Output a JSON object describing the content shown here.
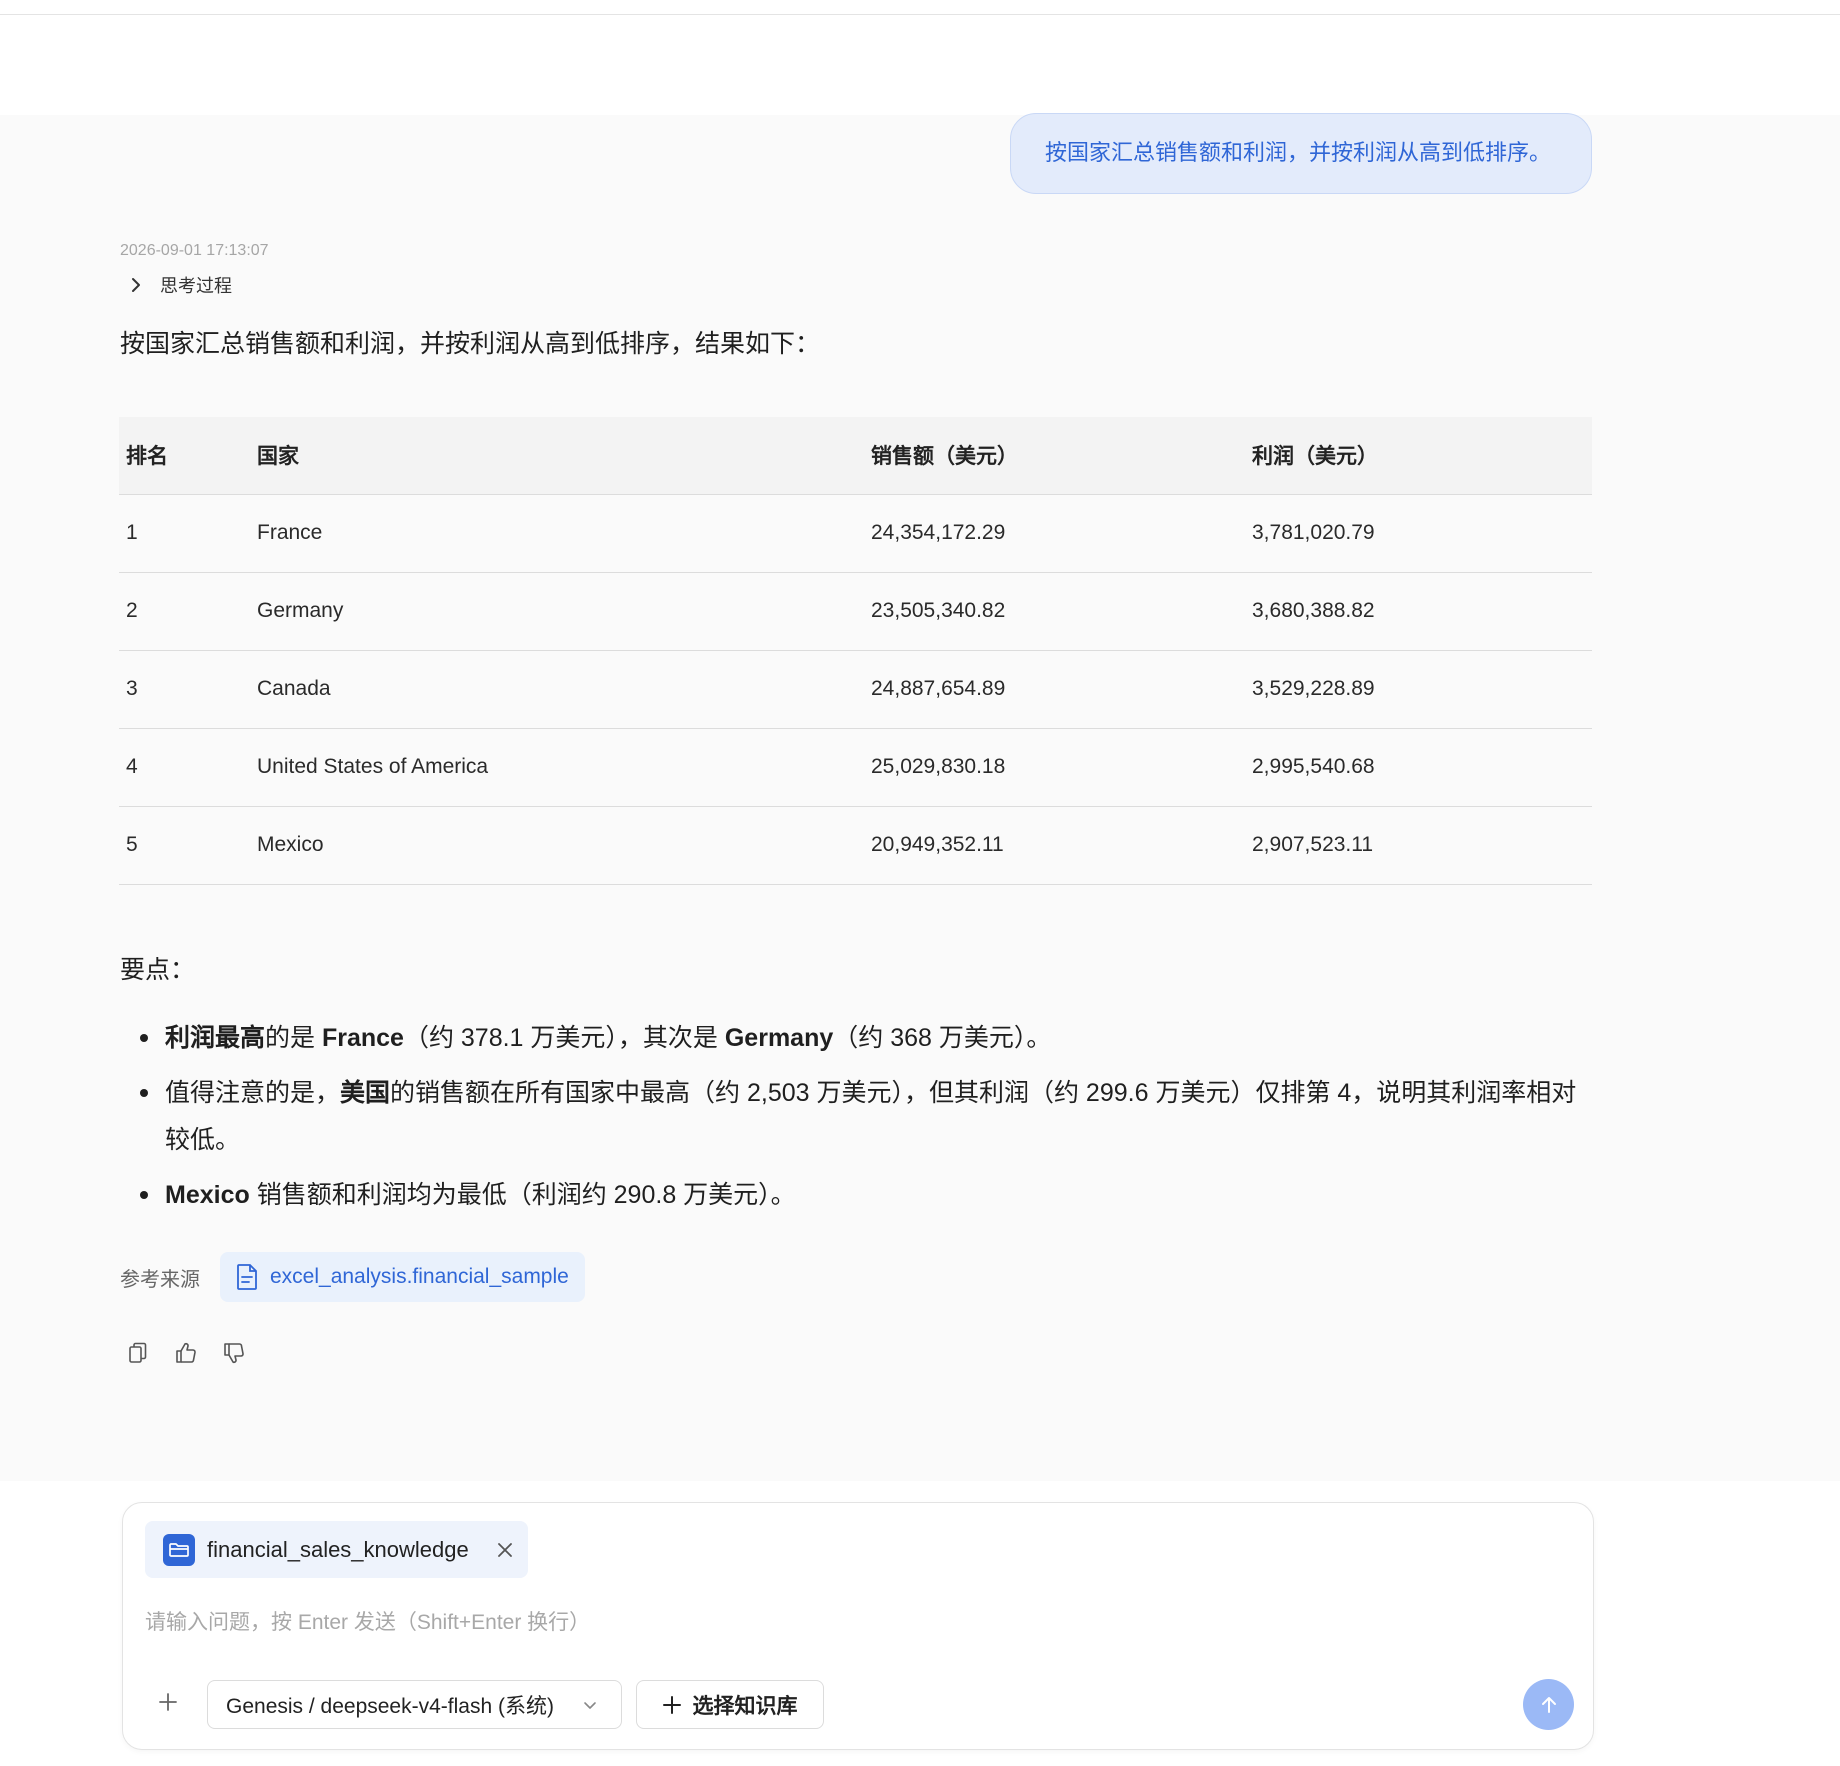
{
  "user_message": "按国家汇总销售额和利润，并按利润从高到低排序。",
  "assistant": {
    "timestamp": "2026-09-01 17:13:07",
    "thinking_label": "思考过程",
    "intro": "按国家汇总销售额和利润，并按利润从高到低排序，结果如下：",
    "table": {
      "headers": [
        "排名",
        "国家",
        "销售额（美元）",
        "利润（美元）"
      ],
      "rows": [
        [
          "1",
          "France",
          "24,354,172.29",
          "3,781,020.79"
        ],
        [
          "2",
          "Germany",
          "23,505,340.82",
          "3,680,388.82"
        ],
        [
          "3",
          "Canada",
          "24,887,654.89",
          "3,529,228.89"
        ],
        [
          "4",
          "United States of America",
          "25,029,830.18",
          "2,995,540.68"
        ],
        [
          "5",
          "Mexico",
          "20,949,352.11",
          "2,907,523.11"
        ]
      ]
    },
    "points_title": "要点：",
    "points": [
      {
        "b1": "利润最高",
        "t1": "的是 ",
        "b2": "France",
        "t2": "（约 378.1 万美元），其次是 ",
        "b3": "Germany",
        "t3": "（约 368 万美元）。"
      },
      {
        "t1": "值得注意的是，",
        "b1": "美国",
        "t2": "的销售额在所有国家中最高（约 2,503 万美元），但其利润（约 299.6 万美元）仅排第 4，说明其利润率相对较低。"
      },
      {
        "b1": "Mexico",
        "t1": " 销售额和利润均为最低（利润约 290.8 万美元）。"
      }
    ],
    "sources_label": "参考来源",
    "source_name": "excel_analysis.financial_sample",
    "actions": [
      "copy-icon",
      "thumbs-up-icon",
      "thumbs-down-icon"
    ]
  },
  "composer": {
    "kb_chip_name": "financial_sales_knowledge",
    "placeholder": "请输入问题，按 Enter 发送（Shift+Enter 换行）",
    "model": "Genesis / deepseek-v4-flash (系统)",
    "kb_button": "选择知识库"
  },
  "colors": {
    "accent": "#2f66d6",
    "send": "#9bb9f6",
    "bubble": "#e3ebfb"
  }
}
